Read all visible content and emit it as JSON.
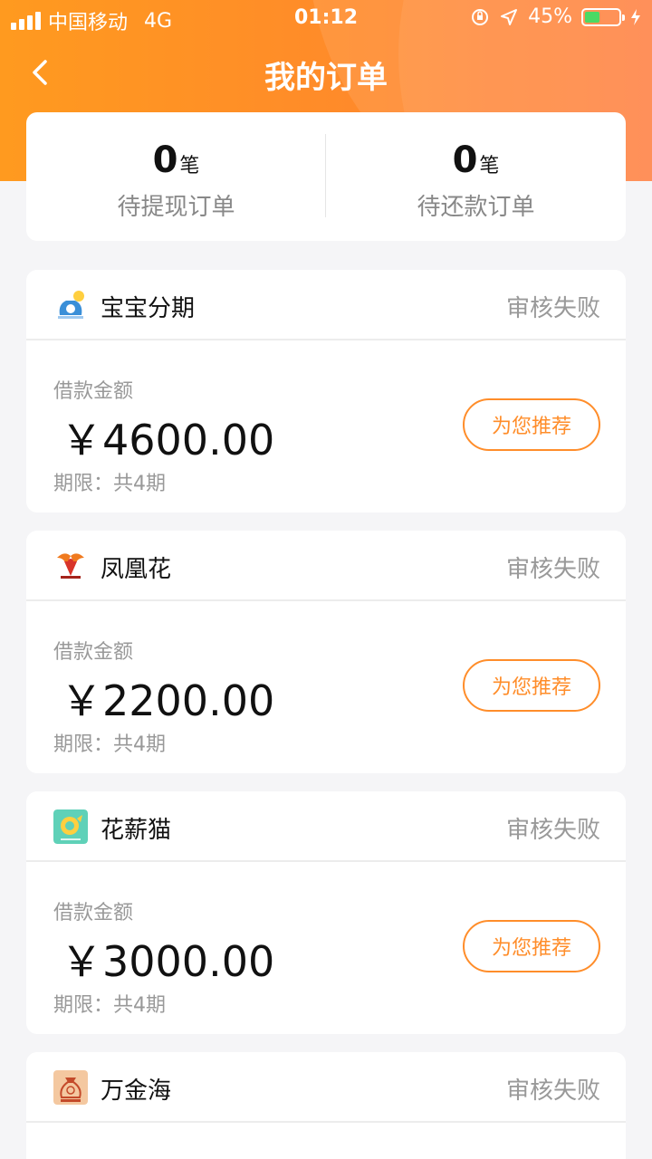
{
  "status_bar": {
    "carrier": "中国移动",
    "network": "4G",
    "time": "01:12",
    "battery": "45%"
  },
  "nav": {
    "title": "我的订单"
  },
  "summary": {
    "pending_withdraw": {
      "count": "0",
      "unit": "笔",
      "label": "待提现订单"
    },
    "pending_repay": {
      "count": "0",
      "unit": "笔",
      "label": "待还款订单"
    }
  },
  "orders": [
    {
      "app": "宝宝分期",
      "status": "审核失败",
      "amount_label": "借款金额",
      "amount": "￥4600.00",
      "term": "期限：共4期",
      "button": "为您推荐"
    },
    {
      "app": "凤凰花",
      "status": "审核失败",
      "amount_label": "借款金额",
      "amount": "￥2200.00",
      "term": "期限：共4期",
      "button": "为您推荐"
    },
    {
      "app": "花薪猫",
      "status": "审核失败",
      "amount_label": "借款金额",
      "amount": "￥3000.00",
      "term": "期限：共4期",
      "button": "为您推荐"
    },
    {
      "app": "万金海",
      "status": "审核失败"
    }
  ],
  "colors": {
    "accent": "#ff8d2a",
    "header_start": "#ff9a1f",
    "header_end": "#ff7b3a"
  }
}
